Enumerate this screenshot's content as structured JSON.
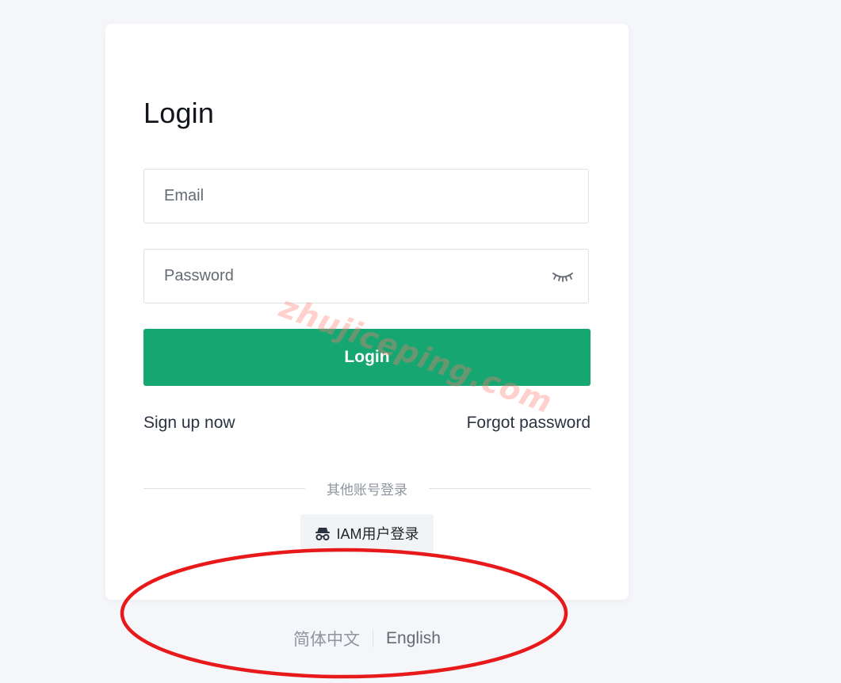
{
  "login": {
    "title": "Login",
    "email_placeholder": "Email",
    "password_placeholder": "Password",
    "password_toggle_icon": "eye-closed-icon",
    "submit_label": "Login",
    "signup_link": "Sign up now",
    "forgot_link": "Forgot password",
    "other_login_label": "其他账号登录",
    "iam_button_label": "IAM用户登录",
    "iam_icon": "incognito-icon"
  },
  "language": {
    "options": [
      "简体中文",
      "English"
    ],
    "selected": "English"
  },
  "overlay": {
    "watermark": "zhujiceping.com",
    "annotation": "red-ellipse"
  },
  "colors": {
    "background": "#f5f6fa",
    "card": "#ffffff",
    "primary": "#16a672",
    "annotation": "#e8191a"
  }
}
